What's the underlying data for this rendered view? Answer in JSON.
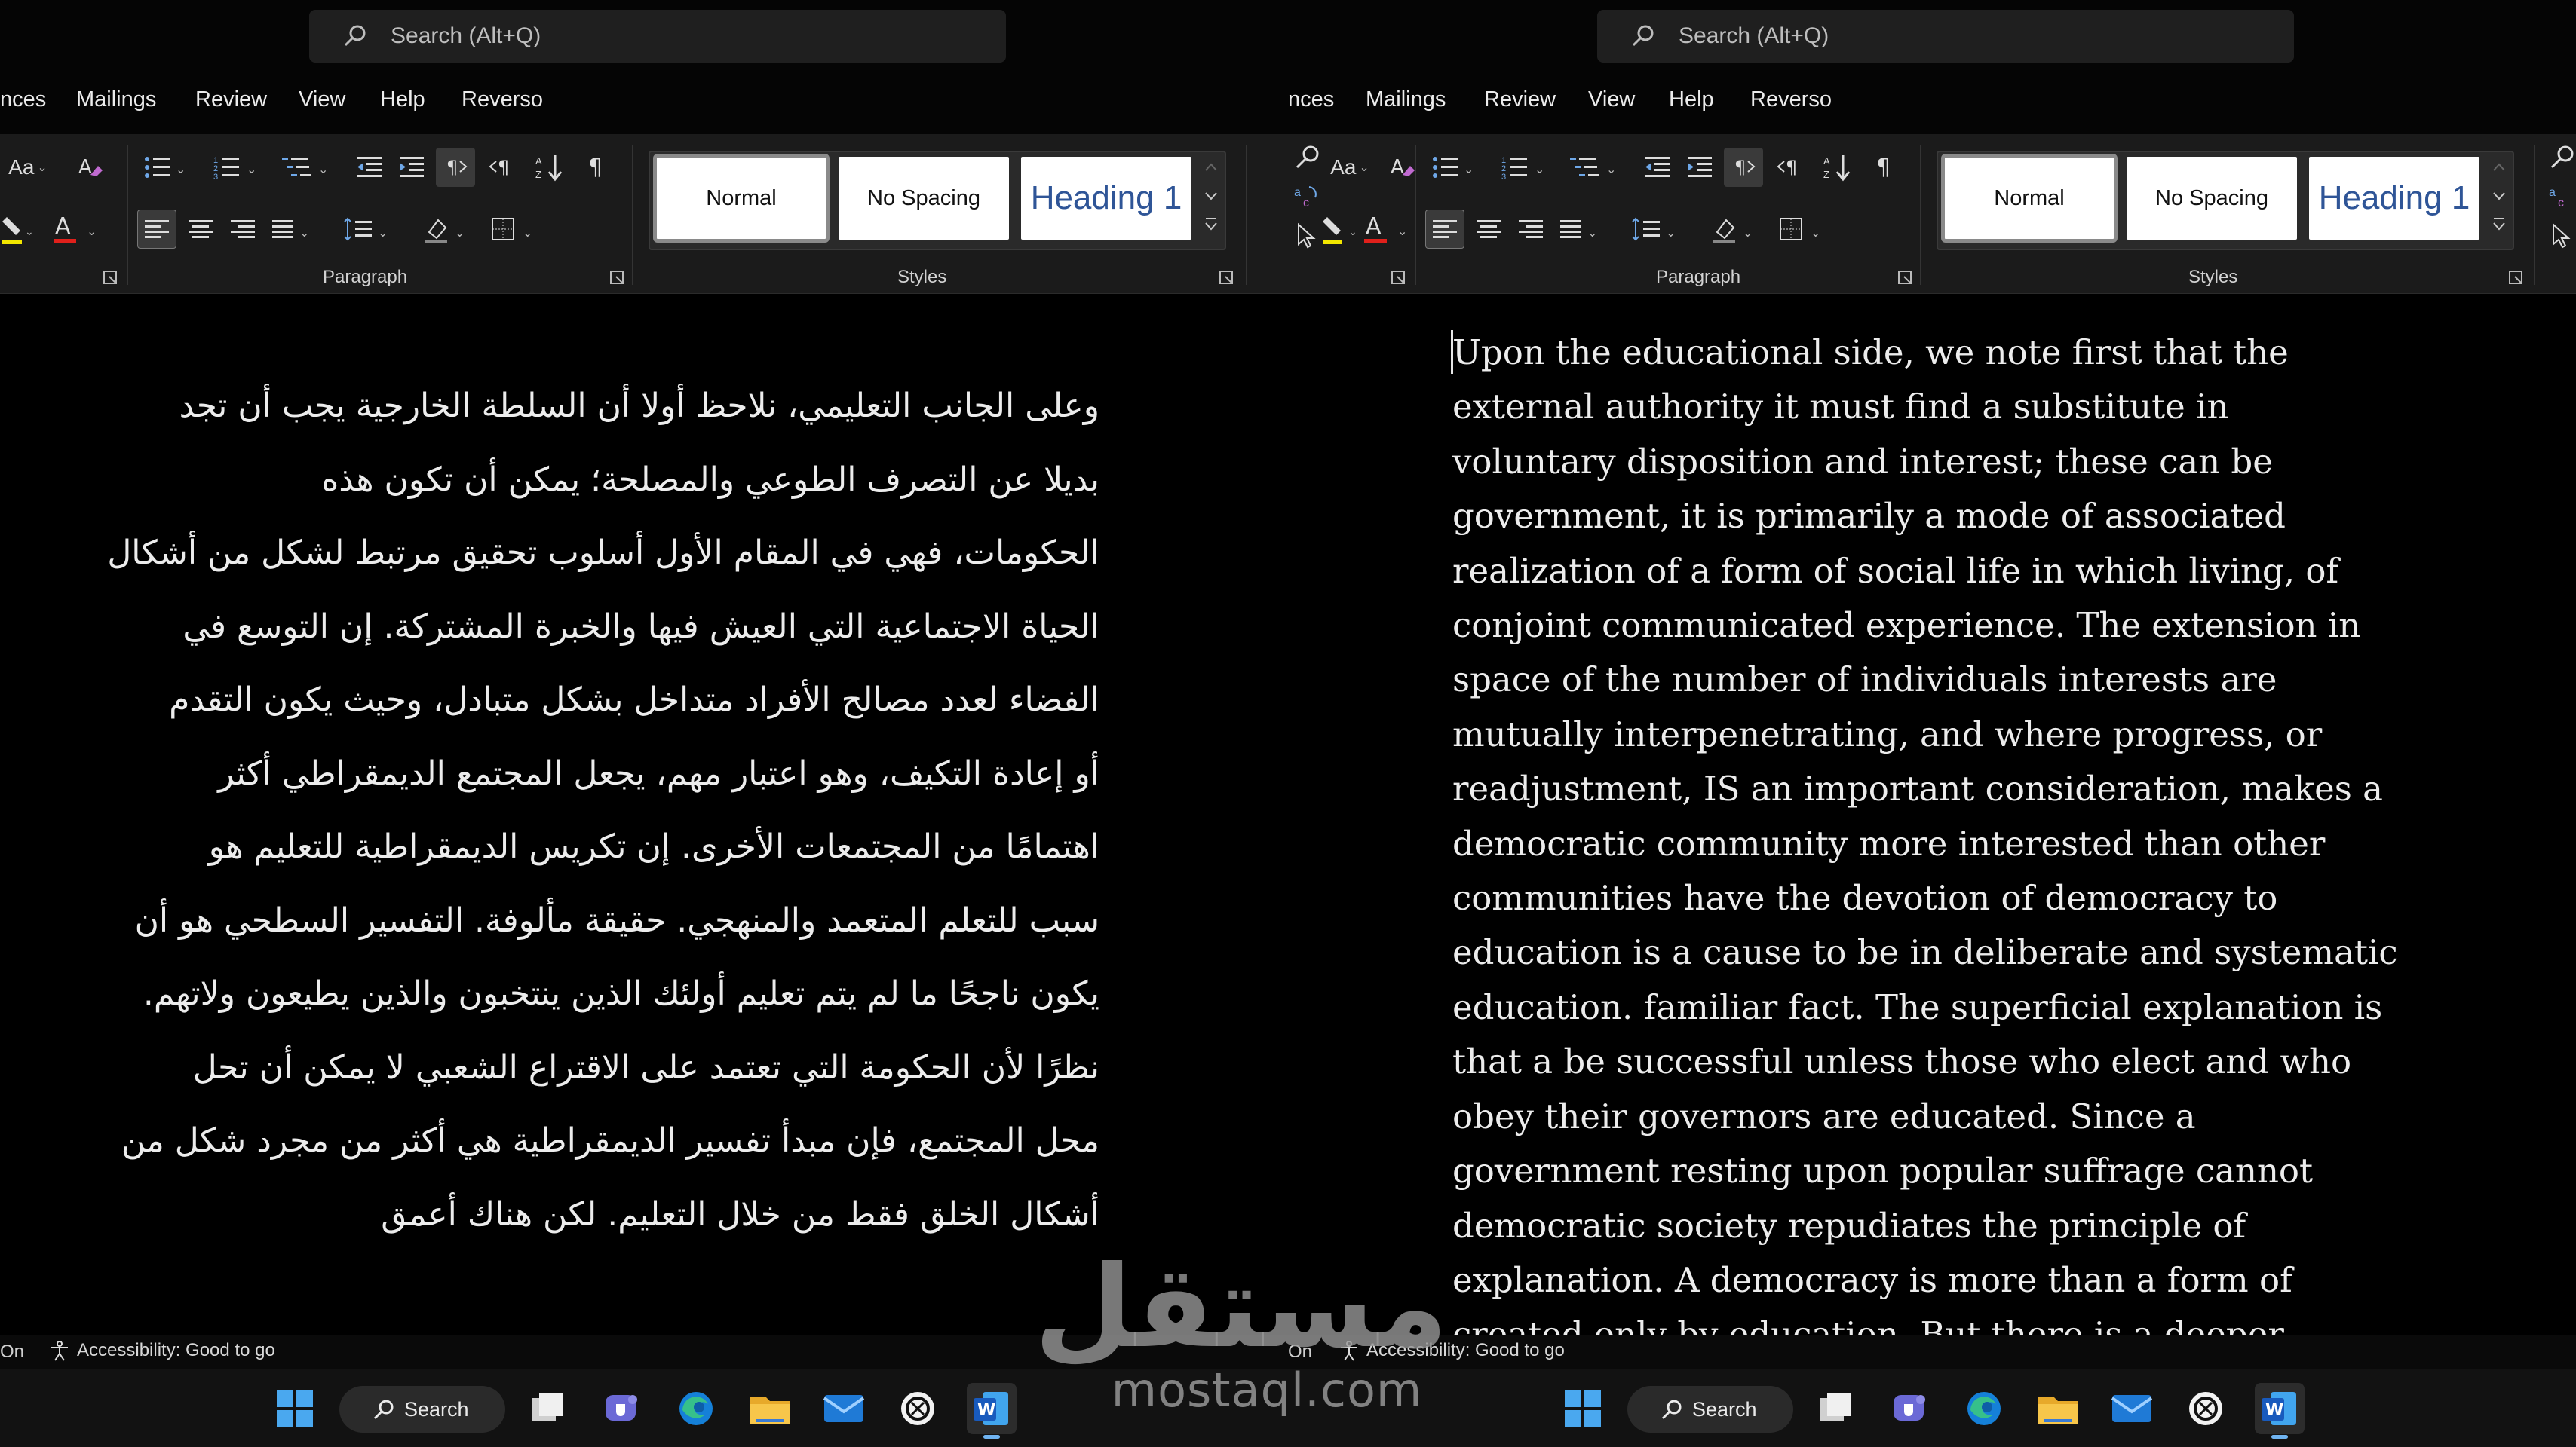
{
  "titlebar": {
    "search_placeholder": "Search (Alt+Q)"
  },
  "menu": [
    "nces",
    "Mailings",
    "Review",
    "View",
    "Help",
    "Reverso"
  ],
  "menu_left_first": "nces",
  "ribbon": {
    "font_case_label": "Aa",
    "paragraph_label": "Paragraph",
    "styles_label": "Styles",
    "styles": [
      "Normal",
      "No Spacing",
      "Heading 1"
    ],
    "colors": {
      "highlight": "#f2e600",
      "font_color": "#e0201b",
      "heading": "#2f5597"
    }
  },
  "document_left": {
    "language": "ar",
    "lines": [
      "وعلى الجانب التعليمي، نلاحظ أولا أن السلطة الخارجية يجب أن تجد",
      "بديلا عن التصرف الطوعي والمصلحة؛ يمكن أن تكون هذه",
      "الحكومات، فهي في المقام الأول أسلوب تحقيق مرتبط لشكل من أشكال",
      "الحياة الاجتماعية التي العيش فيها والخبرة المشتركة. إن التوسع في",
      "الفضاء لعدد مصالح الأفراد متداخل بشكل متبادل، وحيث يكون التقدم",
      "أو إعادة التكيف، وهو اعتبار مهم، يجعل المجتمع الديمقراطي أكثر",
      "اهتمامًا من المجتمعات الأخرى. إن تكريس الديمقراطية للتعليم هو",
      "سبب للتعلم المتعمد والمنهجي. حقيقة مألوفة. التفسير السطحي هو أن",
      "يكون ناجحًا ما لم يتم تعليم أولئك الذين ينتخبون والذين يطيعون ولاتهم.",
      "نظرًا لأن الحكومة التي تعتمد على الاقتراع الشعبي لا يمكن أن تحل",
      "محل المجتمع، فإن مبدأ تفسير الديمقراطية هي أكثر من مجرد شكل من",
      "أشكال الخلق فقط من خلال التعليم. لكن هناك أعمق"
    ]
  },
  "document_right": {
    "language": "en",
    "lines": [
      "Upon the educational side, we note first that the",
      "external authority it must find a substitute in",
      "voluntary disposition and interest; these can be",
      "government, it is primarily a mode of associated",
      "realization of a form of social life in which living, of",
      "conjoint communicated experience. The extension in",
      "space of the number of individuals interests are",
      "mutually interpenetrating, and where progress, or",
      "readjustment, IS an important consideration, makes a",
      "democratic community more interested than other",
      "communities have the devotion of democracy to",
      "education is a cause to be in deliberate and systematic",
      "education. familiar fact. The superficial explanation is",
      "that a be successful unless those who elect and who",
      "obey their governors are educated. Since a",
      "government resting upon popular suffrage cannot",
      "democratic society repudiates the principle of",
      "explanation. A democracy is more than a form of",
      "created only by education. But there is a deeper"
    ]
  },
  "statusbar": {
    "page_fragment": "On",
    "accessibility": "Accessibility: Good to go"
  },
  "taskbar": {
    "search_label": "Search",
    "apps": [
      "start-icon",
      "search-icon",
      "task-view-icon",
      "teams-icon",
      "edge-icon",
      "file-explorer-icon",
      "mail-icon",
      "chatgpt-icon",
      "word-icon"
    ]
  },
  "watermark": {
    "arabic": "مستقل",
    "latin": "mostaql.com"
  }
}
